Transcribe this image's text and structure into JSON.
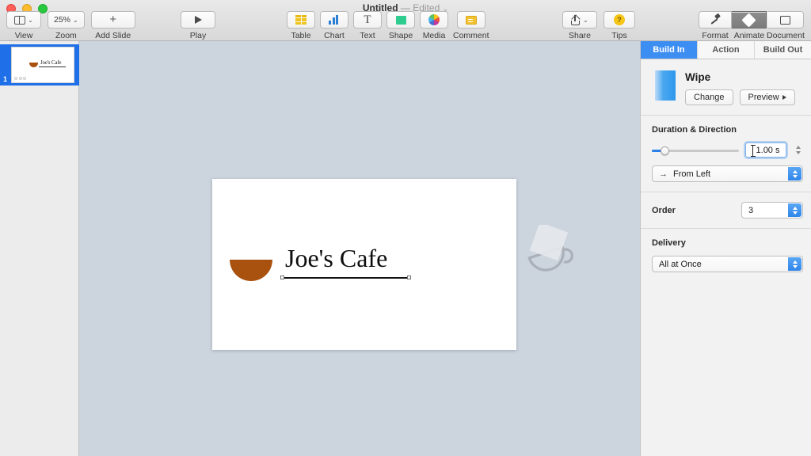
{
  "window": {
    "title": "Untitled",
    "dash": "—",
    "edited": "Edited",
    "chevron": "⌄"
  },
  "toolbar": {
    "left": [
      {
        "label": "View",
        "icon": "view-layout-icon",
        "has_chevron": true
      },
      {
        "label": "Zoom",
        "icon": "zoom-percent-icon",
        "value": "25%",
        "has_chevron": true
      },
      {
        "label": "Add Slide",
        "icon": "plus-icon",
        "has_chevron": false
      }
    ],
    "play": {
      "label": "Play",
      "icon": "play-triangle-icon"
    },
    "insert": [
      {
        "label": "Table",
        "icon": "table-icon"
      },
      {
        "label": "Chart",
        "icon": "bar-chart-icon"
      },
      {
        "label": "Text",
        "icon": "text-t-icon"
      },
      {
        "label": "Shape",
        "icon": "shape-square-icon"
      },
      {
        "label": "Media",
        "icon": "media-pinwheel-icon"
      },
      {
        "label": "Comment",
        "icon": "comment-note-icon"
      }
    ],
    "share": {
      "label": "Share",
      "icon": "share-upload-icon",
      "has_chevron": true
    },
    "tips": {
      "label": "Tips",
      "icon": "tips-lightbulb-icon",
      "glyph": "?"
    },
    "inspectors": [
      {
        "label": "Format",
        "icon": "format-brush-icon",
        "active": false
      },
      {
        "label": "Animate",
        "icon": "animate-diamond-icon",
        "active": true
      },
      {
        "label": "Document",
        "icon": "document-page-icon",
        "active": false
      }
    ]
  },
  "navigator": {
    "slides": [
      {
        "number": "1",
        "title_text": "Joe's Cafe",
        "build_dot_count": 3,
        "selected": true
      }
    ]
  },
  "canvas": {
    "slide": {
      "title_text": "Joe's Cafe",
      "cup_color": "#a9510f",
      "background": "#ffffff"
    },
    "offslide_ghost": "cup-ghost-shape"
  },
  "inspector": {
    "tabs": [
      {
        "label": "Build In",
        "active": true
      },
      {
        "label": "Action",
        "active": false
      },
      {
        "label": "Build Out",
        "active": false
      }
    ],
    "effect": {
      "name": "Wipe",
      "change_label": "Change",
      "preview_label": "Preview"
    },
    "duration": {
      "section_label": "Duration & Direction",
      "value": "1.00 s",
      "slider_percent": 10
    },
    "direction": {
      "arrow": "→",
      "value": "From Left"
    },
    "order": {
      "label": "Order",
      "value": "3"
    },
    "delivery": {
      "label": "Delivery",
      "value": "All at Once"
    }
  },
  "colors": {
    "accent_blue": "#3d8ef2",
    "selection_blue": "#1e6fe8",
    "canvas_bg": "#ccd4de",
    "cup_brown": "#a9510f"
  }
}
